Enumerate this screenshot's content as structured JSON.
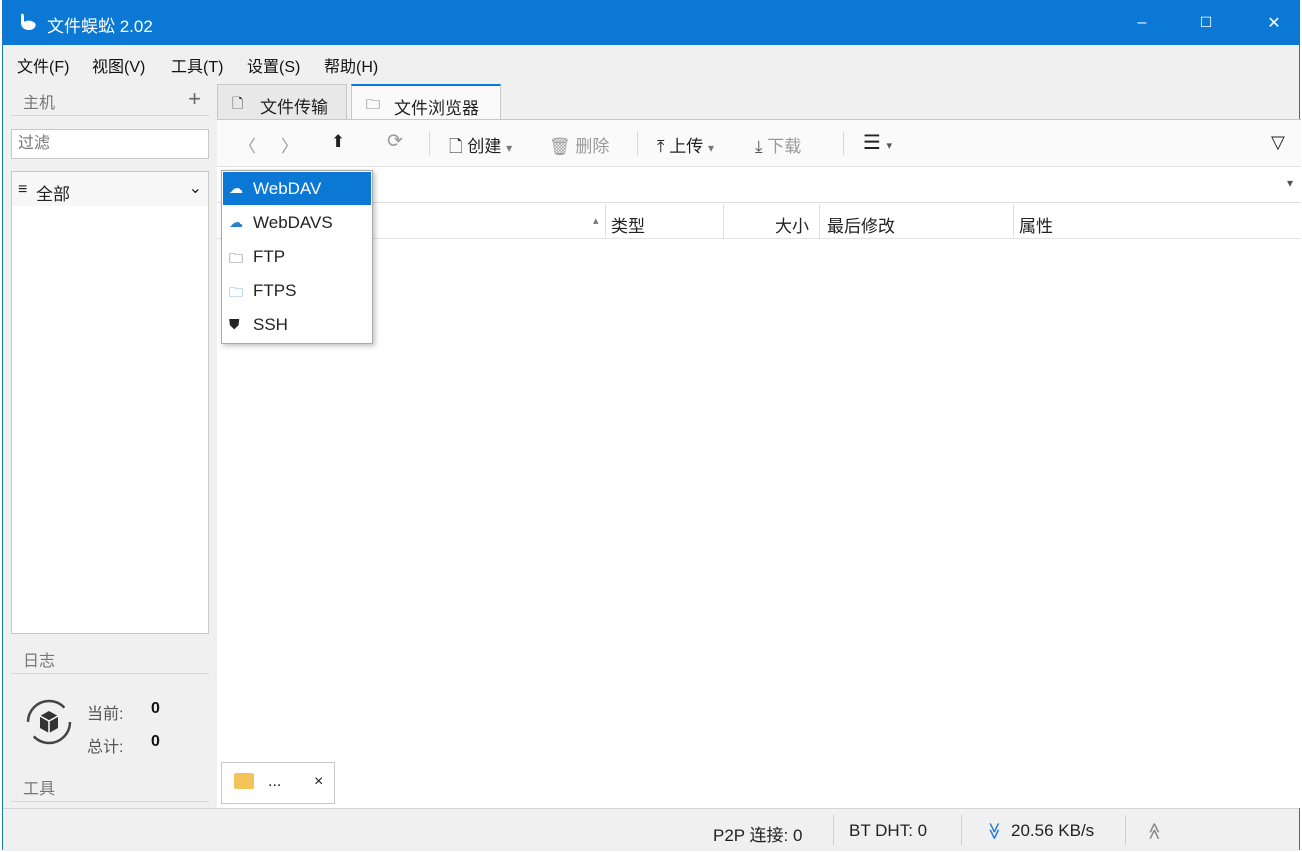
{
  "window": {
    "title": "文件蜈蚣 2.02",
    "minimize": "–",
    "maximize": "☐",
    "close": "✕"
  },
  "menu": [
    "文件(F)",
    "视图(V)",
    "工具(T)",
    "设置(S)",
    "帮助(H)"
  ],
  "hosts": {
    "header": "主机",
    "add": "+",
    "filter_placeholder": "过滤",
    "select": "全部",
    "select_icon": "≡",
    "chevron": "⌄"
  },
  "log": {
    "header": "日志",
    "current_label": "当前:",
    "current_value": "0",
    "total_label": "总计:",
    "total_value": "0"
  },
  "tools": {
    "header": "工具"
  },
  "tabs": [
    {
      "label": "文件传输",
      "icon": "🗋"
    },
    {
      "label": "文件浏览器",
      "icon": "🗀"
    }
  ],
  "toolbar": {
    "back": "〈",
    "forward": "〉",
    "up": "⬆",
    "refresh": "⟳",
    "create": "创建",
    "delete": "删除",
    "upload": "上传",
    "download": "下载",
    "menu": "☰",
    "filter": "▽",
    "caret": "▾"
  },
  "columns": {
    "name_sort": "▴",
    "type": "类型",
    "size": "大小",
    "modified": "最后修改",
    "attributes": "属性"
  },
  "dropdown": [
    {
      "label": "WebDAV",
      "icon": "☁",
      "selected": true
    },
    {
      "label": "WebDAVS",
      "icon": "☁",
      "selected": false
    },
    {
      "label": "FTP",
      "icon": "🗀",
      "selected": false
    },
    {
      "label": "FTPS",
      "icon": "🗀",
      "selected": false
    },
    {
      "label": "SSH",
      "icon": "⛊",
      "selected": false
    }
  ],
  "bottom_tab": {
    "label": "...",
    "close": "×"
  },
  "status": {
    "p2p": "P2P 连接: 0",
    "bt_dht": "BT DHT: 0",
    "download_speed": "20.56 KB/s",
    "down_icon": "≫",
    "up_icon": "≪"
  }
}
